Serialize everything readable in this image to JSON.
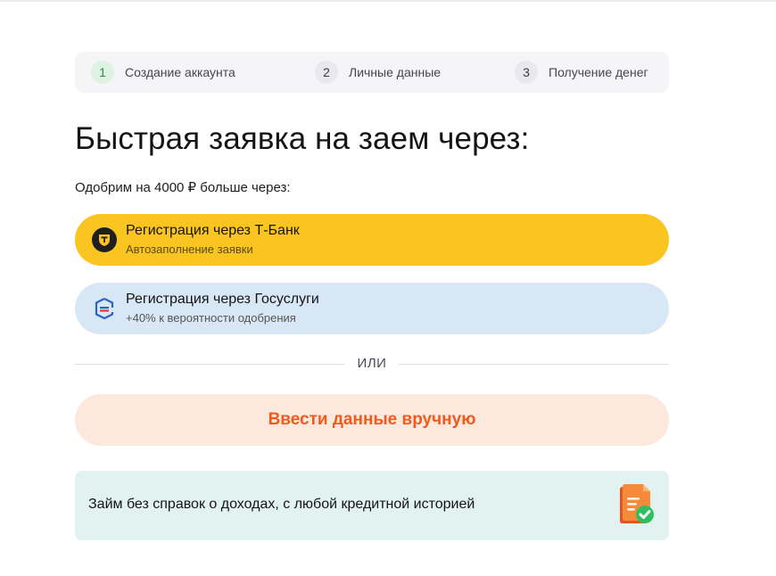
{
  "steps": [
    {
      "num": "1",
      "label": "Создание аккаунта",
      "state": "active"
    },
    {
      "num": "2",
      "label": "Личные данные",
      "state": "pending"
    },
    {
      "num": "3",
      "label": "Получение денег",
      "state": "pending"
    }
  ],
  "title": "Быстрая заявка на заем через:",
  "subtitle": "Одобрим на 4000 ₽ больше через:",
  "options": [
    {
      "title": "Регистрация через Т-Банк",
      "subtitle": "Автозаполнение заявки",
      "icon": "tbank-icon",
      "color": "#fac520"
    },
    {
      "title": "Регистрация через Госуслуги",
      "subtitle": "+40% к вероятности одобрения",
      "icon": "gosuslugi-icon",
      "color": "#d8e7f6"
    }
  ],
  "divider_text": "ИЛИ",
  "manual_button": {
    "label": "Ввести данные вручную",
    "color": "#f15a1f",
    "background": "#fde8dd"
  },
  "info": {
    "text": "Займ без справок о доходах, с любой кредитной историей",
    "icon": "document-check-icon"
  },
  "colors": {
    "accent": "#f15a1f",
    "step_active": "#2d8a48",
    "tbank": "#fac520",
    "gosuslugi": "#d8e7f6",
    "info_bg": "#e2f2f0"
  }
}
